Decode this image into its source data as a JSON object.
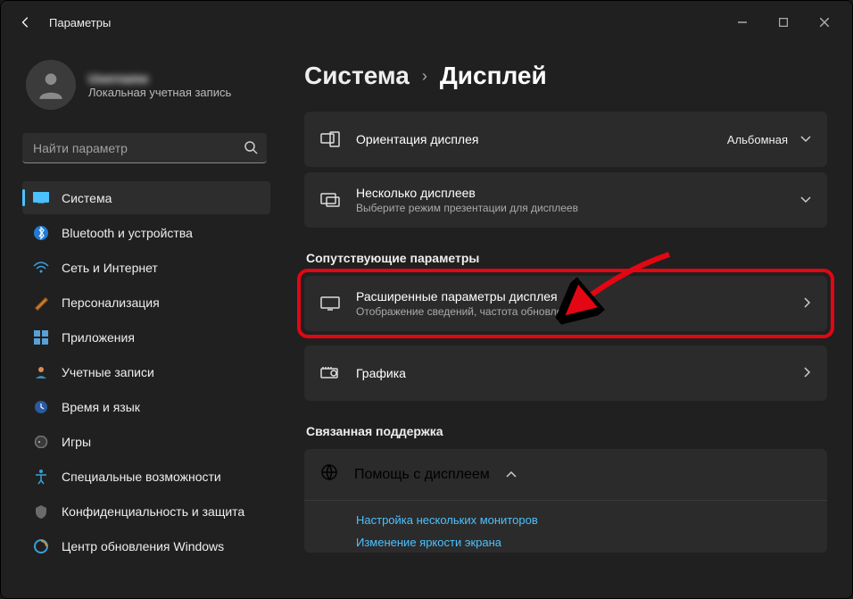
{
  "window": {
    "title": "Параметры"
  },
  "user": {
    "name": "Username",
    "account_type": "Локальная учетная запись"
  },
  "search": {
    "placeholder": "Найти параметр"
  },
  "sidebar": {
    "items": [
      {
        "label": "Система"
      },
      {
        "label": "Bluetooth и устройства"
      },
      {
        "label": "Сеть и Интернет"
      },
      {
        "label": "Персонализация"
      },
      {
        "label": "Приложения"
      },
      {
        "label": "Учетные записи"
      },
      {
        "label": "Время и язык"
      },
      {
        "label": "Игры"
      },
      {
        "label": "Специальные возможности"
      },
      {
        "label": "Конфиденциальность и защита"
      },
      {
        "label": "Центр обновления Windows"
      }
    ]
  },
  "breadcrumb": {
    "root": "Система",
    "leaf": "Дисплей"
  },
  "cards": {
    "orientation": {
      "title": "Ориентация дисплея",
      "value": "Альбомная"
    },
    "multiple": {
      "title": "Несколько дисплеев",
      "subtitle": "Выберите режим презентации для дисплеев"
    },
    "advanced": {
      "title": "Расширенные параметры дисплея",
      "subtitle": "Отображение сведений, частота обновления"
    },
    "graphics": {
      "title": "Графика"
    }
  },
  "sections": {
    "related": "Сопутствующие параметры",
    "support": "Связанная поддержка"
  },
  "help": {
    "title": "Помощь с дисплеем",
    "links": [
      "Настройка нескольких мониторов",
      "Изменение яркости экрана"
    ]
  }
}
